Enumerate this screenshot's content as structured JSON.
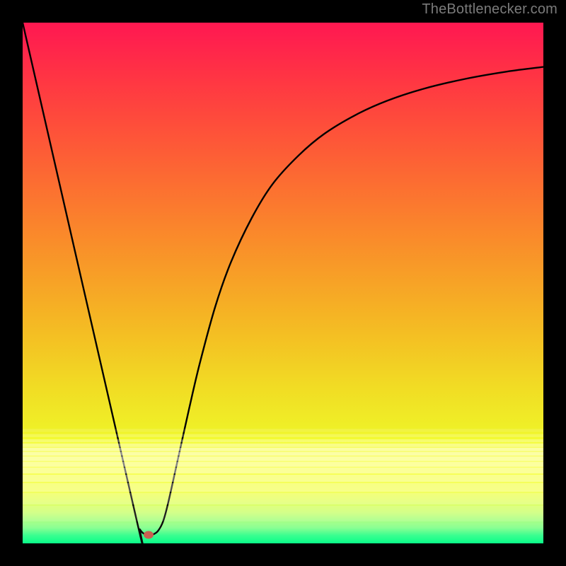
{
  "attribution": "TheBottlenecker.com",
  "chart_data": {
    "type": "line",
    "title": "",
    "xlabel": "",
    "ylabel": "",
    "xlim": [
      0,
      100
    ],
    "ylim": [
      0,
      100
    ],
    "background_gradient_stops": [
      {
        "offset": 0.0,
        "color": "#ff1850"
      },
      {
        "offset": 0.02,
        "color": "#ff1d4f"
      },
      {
        "offset": 0.1,
        "color": "#ff3344"
      },
      {
        "offset": 0.2,
        "color": "#fe4f3a"
      },
      {
        "offset": 0.3,
        "color": "#fc6b32"
      },
      {
        "offset": 0.4,
        "color": "#fa872b"
      },
      {
        "offset": 0.5,
        "color": "#f7a326"
      },
      {
        "offset": 0.6,
        "color": "#f4bf23"
      },
      {
        "offset": 0.7,
        "color": "#f1dc24"
      },
      {
        "offset": 0.78,
        "color": "#eff027"
      },
      {
        "offset": 0.8,
        "color": "#f3fb2e"
      },
      {
        "offset": 0.85,
        "color": "#f8ff3a"
      },
      {
        "offset": 0.9,
        "color": "#f3ff52"
      },
      {
        "offset": 0.94,
        "color": "#cfff79"
      },
      {
        "offset": 0.97,
        "color": "#86ff8f"
      },
      {
        "offset": 0.985,
        "color": "#31fe8c"
      },
      {
        "offset": 1.0,
        "color": "#00fd85"
      }
    ],
    "series": [
      {
        "name": "bottleneck-curve",
        "points": [
          {
            "x": 0.0,
            "y": 100.0
          },
          {
            "x": 22.0,
            "y": 4.0
          },
          {
            "x": 22.5,
            "y": 2.7
          },
          {
            "x": 23.2,
            "y": 1.9
          },
          {
            "x": 24.0,
            "y": 1.6
          },
          {
            "x": 25.0,
            "y": 1.7
          },
          {
            "x": 26.0,
            "y": 2.4
          },
          {
            "x": 27.0,
            "y": 4.3
          },
          {
            "x": 28.0,
            "y": 8.0
          },
          {
            "x": 30.0,
            "y": 17.0
          },
          {
            "x": 32.0,
            "y": 26.0
          },
          {
            "x": 34.0,
            "y": 34.5
          },
          {
            "x": 37.0,
            "y": 45.5
          },
          {
            "x": 40.0,
            "y": 54.0
          },
          {
            "x": 44.0,
            "y": 62.5
          },
          {
            "x": 48.0,
            "y": 69.0
          },
          {
            "x": 53.0,
            "y": 74.5
          },
          {
            "x": 58.0,
            "y": 78.7
          },
          {
            "x": 64.0,
            "y": 82.3
          },
          {
            "x": 70.0,
            "y": 85.0
          },
          {
            "x": 77.0,
            "y": 87.3
          },
          {
            "x": 85.0,
            "y": 89.2
          },
          {
            "x": 93.0,
            "y": 90.6
          },
          {
            "x": 100.0,
            "y": 91.5
          }
        ]
      }
    ],
    "marker": {
      "x": 24.2,
      "y": 1.6,
      "color": "#c85a4a"
    },
    "whiteout_bands": [
      {
        "y": 0.78,
        "h": 0.006,
        "alpha": 0.12
      },
      {
        "y": 0.79,
        "h": 0.006,
        "alpha": 0.2
      },
      {
        "y": 0.8,
        "h": 0.006,
        "alpha": 0.3
      },
      {
        "y": 0.808,
        "h": 0.007,
        "alpha": 0.42
      },
      {
        "y": 0.816,
        "h": 0.007,
        "alpha": 0.55
      },
      {
        "y": 0.824,
        "h": 0.008,
        "alpha": 0.56
      },
      {
        "y": 0.833,
        "h": 0.009,
        "alpha": 0.55
      },
      {
        "y": 0.843,
        "h": 0.01,
        "alpha": 0.52
      },
      {
        "y": 0.854,
        "h": 0.012,
        "alpha": 0.47
      },
      {
        "y": 0.868,
        "h": 0.014,
        "alpha": 0.4
      },
      {
        "y": 0.884,
        "h": 0.017,
        "alpha": 0.32
      },
      {
        "y": 0.903,
        "h": 0.022,
        "alpha": 0.22
      },
      {
        "y": 0.928,
        "h": 0.03,
        "alpha": 0.12
      },
      {
        "y": 0.96,
        "h": 0.04,
        "alpha": 0.04
      }
    ]
  }
}
